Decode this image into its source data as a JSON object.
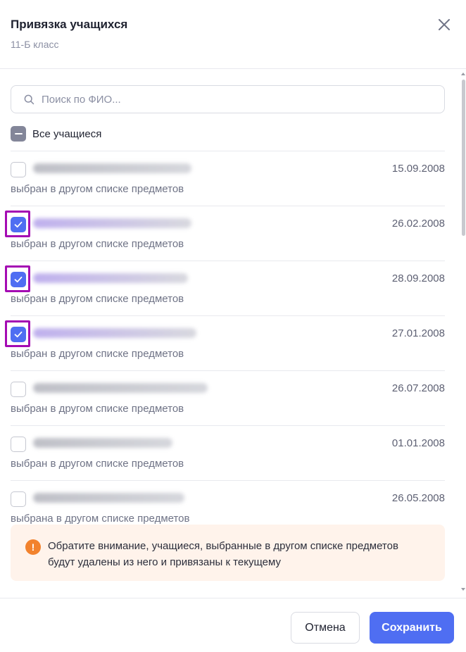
{
  "header": {
    "title": "Привязка учащихся",
    "subtitle": "11-Б класс"
  },
  "search": {
    "placeholder": "Поиск по ФИО..."
  },
  "select_all": {
    "label": "Все учащиеся",
    "state": "indeterminate"
  },
  "students": [
    {
      "checked": false,
      "date": "15.09.2008",
      "note": "выбран в другом списке предметов"
    },
    {
      "checked": true,
      "date": "26.02.2008",
      "note": "выбран в другом списке предметов"
    },
    {
      "checked": true,
      "date": "28.09.2008",
      "note": "выбран в другом списке предметов"
    },
    {
      "checked": true,
      "date": "27.01.2008",
      "note": "выбран в другом списке предметов"
    },
    {
      "checked": false,
      "date": "26.07.2008",
      "note": "выбран в другом списке предметов"
    },
    {
      "checked": false,
      "date": "01.01.2008",
      "note": "выбран в другом списке предметов"
    },
    {
      "checked": false,
      "date": "26.05.2008",
      "note": "выбрана в другом списке предметов"
    }
  ],
  "warning": {
    "icon": "exclamation-icon",
    "text": "Обратите внимание, учащиеся, выбранные в другом списке предметов будут удалены из него и привязаны к текущему"
  },
  "footer": {
    "cancel_label": "Отмена",
    "save_label": "Сохранить"
  },
  "colors": {
    "accent": "#4f6ef2",
    "warning": "#f2822d",
    "highlight": "#a40bb3"
  }
}
